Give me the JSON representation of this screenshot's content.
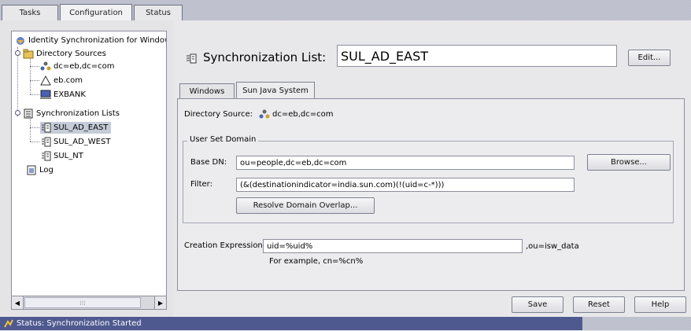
{
  "top_tabs": [
    {
      "label": "Tasks"
    },
    {
      "label": "Configuration"
    },
    {
      "label": "Status"
    }
  ],
  "tree": {
    "root": "Identity Synchronization for Window",
    "directory_sources": "Directory Sources",
    "ds_items": [
      "dc=eb,dc=com",
      "eb.com",
      "EXBANK"
    ],
    "sync_lists": "Synchronization Lists",
    "sl_items": [
      "SUL_AD_EAST",
      "SUL_AD_WEST",
      "SUL_NT"
    ],
    "log": "Log"
  },
  "sync_list": {
    "label": "Synchronization List:",
    "value": "SUL_AD_EAST"
  },
  "edit_button": "Edit...",
  "inner_tabs": [
    {
      "label": "Windows"
    },
    {
      "label": "Sun Java System"
    }
  ],
  "directory_source": {
    "label": "Directory Source:",
    "value": "dc=eb,dc=com"
  },
  "user_set_domain": {
    "legend": "User Set Domain",
    "base_dn_label": "Base DN:",
    "base_dn_value": "ou=people,dc=eb,dc=com",
    "filter_label": "Filter:",
    "filter_value": "(&(destinationindicator=india.sun.com)(!(uid=c-*)))",
    "browse_button": "Browse...",
    "resolve_button": "Resolve Domain Overlap..."
  },
  "creation": {
    "label": "Creation Expression:",
    "value": "uid=%uid%",
    "suffix": ",ou=isw_data",
    "example": "For example, cn=%cn%"
  },
  "buttons": {
    "save": "Save",
    "reset": "Reset",
    "help": "Help"
  },
  "status": {
    "text": "Status:  Synchronization Started"
  },
  "colors": {
    "accent": "#5566aa",
    "panel": "#e8e8eb",
    "selection": "#c5ccd8"
  }
}
